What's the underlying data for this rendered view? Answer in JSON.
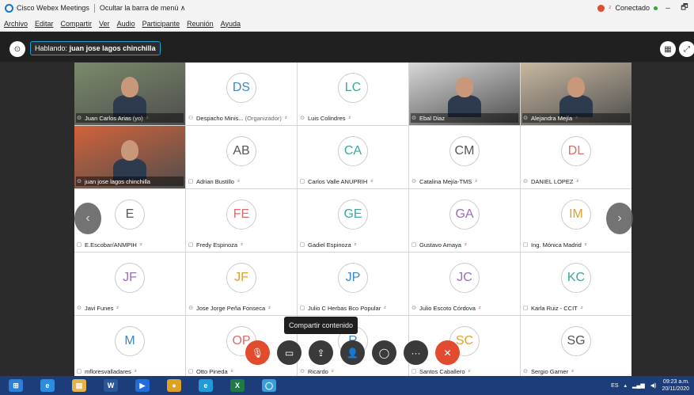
{
  "titlebar": {
    "app_name": "Cisco Webex Meetings",
    "hide_menu": "Ocultar la barra de menú ∧",
    "status": "Conectado",
    "minimize": "–",
    "restore": "🗗"
  },
  "menu": [
    "Archivo",
    "Editar",
    "Compartir",
    "Ver",
    "Audio",
    "Participante",
    "Reunión",
    "Ayuda"
  ],
  "speaking": {
    "label": "Hablando:",
    "name": "juan jose lagos chinchilla"
  },
  "participants": [
    {
      "name": "Juan Carlos Arias",
      "role": "(yo)",
      "initials": "",
      "video": true,
      "device": "phone",
      "muted": true,
      "color": "#7a8a6a"
    },
    {
      "name": "Despacho Minis...",
      "role": "(Organizador)",
      "initials": "DS",
      "video": false,
      "device": "host",
      "muted": true,
      "color": "#3b87c8"
    },
    {
      "name": "Luis Colindres",
      "role": "",
      "initials": "LC",
      "video": false,
      "device": "phone",
      "muted": true,
      "color": "#3aa79a"
    },
    {
      "name": "Ebal Diaz",
      "role": "",
      "initials": "",
      "video": true,
      "device": "phone",
      "muted": false,
      "color": "#d8d8d8"
    },
    {
      "name": "Alejandra Mejía",
      "role": "",
      "initials": "",
      "video": true,
      "device": "phone",
      "muted": true,
      "color": "#c8b8a0"
    },
    {
      "name": "juan jose lagos chinchilla",
      "role": "",
      "initials": "",
      "video": true,
      "device": "phone",
      "muted": false,
      "color": "#d2623a"
    },
    {
      "name": "Adrian Bustillo",
      "role": "",
      "initials": "AB",
      "video": false,
      "device": "computer",
      "muted": true,
      "color": "#555555"
    },
    {
      "name": "Carlos Valle ANUPRIH",
      "role": "",
      "initials": "CA",
      "video": false,
      "device": "computer",
      "muted": true,
      "color": "#3aa79a"
    },
    {
      "name": "Catalina Mejía-TMS",
      "role": "",
      "initials": "CM",
      "video": false,
      "device": "phone",
      "muted": true,
      "color": "#555555"
    },
    {
      "name": "DANIEL LOPEZ",
      "role": "",
      "initials": "DL",
      "video": false,
      "device": "phone",
      "muted": true,
      "color": "#e06a6a"
    },
    {
      "name": "E.Escobar/ANMPIH",
      "role": "",
      "initials": "E",
      "video": false,
      "device": "computer",
      "muted": true,
      "color": "#555555"
    },
    {
      "name": "Fredy Espinoza",
      "role": "",
      "initials": "FE",
      "video": false,
      "device": "computer",
      "muted": true,
      "color": "#e06a6a"
    },
    {
      "name": "Gadiel Espinoza",
      "role": "",
      "initials": "GE",
      "video": false,
      "device": "computer",
      "muted": true,
      "color": "#3aa79a"
    },
    {
      "name": "Gustavo Amaya",
      "role": "",
      "initials": "GA",
      "video": false,
      "device": "computer",
      "muted": true,
      "color": "#9b6bc0"
    },
    {
      "name": "Ing. Mónica Madrid",
      "role": "",
      "initials": "IM",
      "video": false,
      "device": "computer",
      "muted": true,
      "color": "#e0a030"
    },
    {
      "name": "Javi Funes",
      "role": "",
      "initials": "JF",
      "video": false,
      "device": "phone",
      "muted": true,
      "color": "#9b6bc0"
    },
    {
      "name": "Jose Jorge Peña Fonseca",
      "role": "",
      "initials": "JF",
      "video": false,
      "device": "phone",
      "muted": true,
      "color": "#e0a030"
    },
    {
      "name": "Julio C Herbas Bco Popular",
      "role": "",
      "initials": "JP",
      "video": false,
      "device": "computer",
      "muted": true,
      "color": "#3b87c8"
    },
    {
      "name": "Julio Escoto Córdova",
      "role": "",
      "initials": "JC",
      "video": false,
      "device": "phone",
      "muted": true,
      "color": "#9b6bc0"
    },
    {
      "name": "Karla Ruiz - CCIT",
      "role": "",
      "initials": "KC",
      "video": false,
      "device": "computer",
      "muted": true,
      "color": "#3aa79a"
    },
    {
      "name": "mfloresvalladares",
      "role": "",
      "initials": "M",
      "video": false,
      "device": "computer",
      "muted": true,
      "color": "#3b87c8"
    },
    {
      "name": "Otto Pineda",
      "role": "",
      "initials": "OP",
      "video": false,
      "device": "computer",
      "muted": true,
      "color": "#e06a6a"
    },
    {
      "name": "Ricardo",
      "role": "",
      "initials": "R",
      "video": false,
      "device": "phone",
      "muted": true,
      "color": "#3b87c8"
    },
    {
      "name": "Santos Caballero",
      "role": "",
      "initials": "SC",
      "video": false,
      "device": "computer",
      "muted": true,
      "color": "#e0a030"
    },
    {
      "name": "Sergio Garner",
      "role": "",
      "initials": "SG",
      "video": false,
      "device": "phone",
      "muted": true,
      "color": "#555555"
    }
  ],
  "tooltip": "Compartir contenido",
  "controls": [
    {
      "name": "mute-button",
      "icon": "🎙",
      "red": true
    },
    {
      "name": "video-button",
      "icon": "▭",
      "red": false
    },
    {
      "name": "share-button",
      "icon": "⇪",
      "red": false
    },
    {
      "name": "participants-button",
      "icon": "👤",
      "red": false
    },
    {
      "name": "chat-button",
      "icon": "◯",
      "red": false
    },
    {
      "name": "more-button",
      "icon": "···",
      "red": false
    },
    {
      "name": "leave-button",
      "icon": "✕",
      "red": true
    }
  ],
  "taskbar": {
    "apps": [
      {
        "name": "start-button",
        "label": "⊞",
        "color": "#2f7ed8"
      },
      {
        "name": "ie-icon",
        "label": "e",
        "color": "#2a8ee0"
      },
      {
        "name": "file-explorer-icon",
        "label": "▤",
        "color": "#e3b34a"
      },
      {
        "name": "word-icon",
        "label": "W",
        "color": "#2b5797"
      },
      {
        "name": "media-player-icon",
        "label": "▶",
        "color": "#1e6fd9"
      },
      {
        "name": "chrome-icon",
        "label": "●",
        "color": "#e0a020"
      },
      {
        "name": "edge-icon",
        "label": "e",
        "color": "#1f9bd6"
      },
      {
        "name": "excel-icon",
        "label": "X",
        "color": "#1f7a44"
      },
      {
        "name": "webex-taskbar-icon",
        "label": "◯",
        "color": "#3b9ed8"
      }
    ],
    "lang": "ES",
    "time": "09:23 a.m.",
    "date": "20/11/2020"
  }
}
